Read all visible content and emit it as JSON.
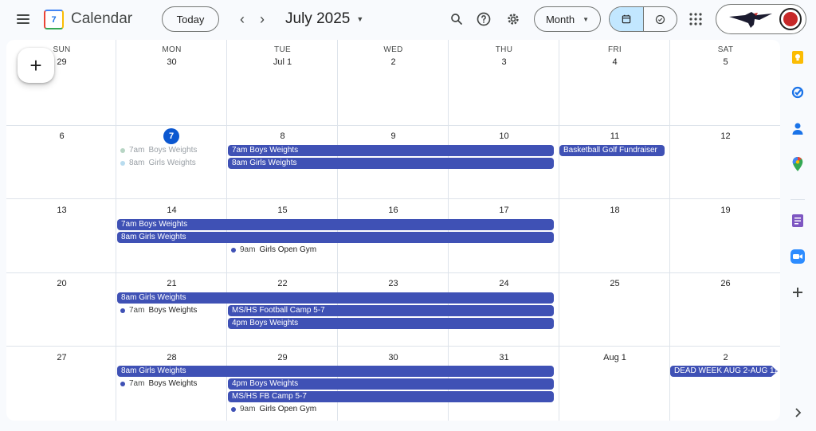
{
  "header": {
    "app_title": "Calendar",
    "logo_day": "7",
    "today_label": "Today",
    "prev_label": "‹",
    "next_label": "›",
    "month_title": "July 2025",
    "view_label": "Month"
  },
  "weekdays": [
    "SUN",
    "MON",
    "TUE",
    "WED",
    "THU",
    "FRI",
    "SAT"
  ],
  "weeks": [
    [
      "29",
      "30",
      "Jul 1",
      "2",
      "3",
      "4",
      "5"
    ],
    [
      "6",
      "7",
      "8",
      "9",
      "10",
      "11",
      "12"
    ],
    [
      "13",
      "14",
      "15",
      "16",
      "17",
      "18",
      "19"
    ],
    [
      "20",
      "21",
      "22",
      "23",
      "24",
      "25",
      "26"
    ],
    [
      "27",
      "28",
      "29",
      "30",
      "31",
      "Aug 1",
      "2"
    ]
  ],
  "events": {
    "w1_mon_boys": {
      "time": "7am",
      "title": "Boys Weights"
    },
    "w1_mon_girls": {
      "time": "8am",
      "title": "Girls Weights"
    },
    "w1_boys_bar": "7am Boys Weights",
    "w1_girls_bar": "8am Girls Weights",
    "w1_fundraiser": "Basketball Golf Fundraiser",
    "w2_boys_bar": "7am Boys Weights",
    "w2_girls_bar": "8am Girls Weights",
    "w2_tue_gym": {
      "time": "9am",
      "title": "Girls Open Gym"
    },
    "w3_girls_bar": "8am Girls Weights",
    "w3_mon_boys": {
      "time": "7am",
      "title": "Boys Weights"
    },
    "w3_football_camp": "MS/HS Football Camp 5-7",
    "w3_boys_4pm": "4pm Boys Weights",
    "w4_girls_bar": "8am Girls Weights",
    "w4_mon_boys": {
      "time": "7am",
      "title": "Boys Weights"
    },
    "w4_boys_4pm": "4pm Boys Weights",
    "w4_fb_camp": "MS/HS FB Camp 5-7",
    "w4_tue_gym": {
      "time": "9am",
      "title": "Girls Open Gym"
    },
    "w4_dead_week": "DEAD WEEK AUG 2-AUG 11"
  },
  "fab_label": "+",
  "colors": {
    "event": "#3f51b5",
    "today": "#0b57d0",
    "active_view": "#c2e7ff"
  },
  "side_panel_icons": [
    "keep-icon",
    "tasks-icon",
    "contacts-icon",
    "maps-icon",
    "notes-icon",
    "zoom-icon",
    "add-addon-icon",
    "expand-chevron-icon"
  ]
}
